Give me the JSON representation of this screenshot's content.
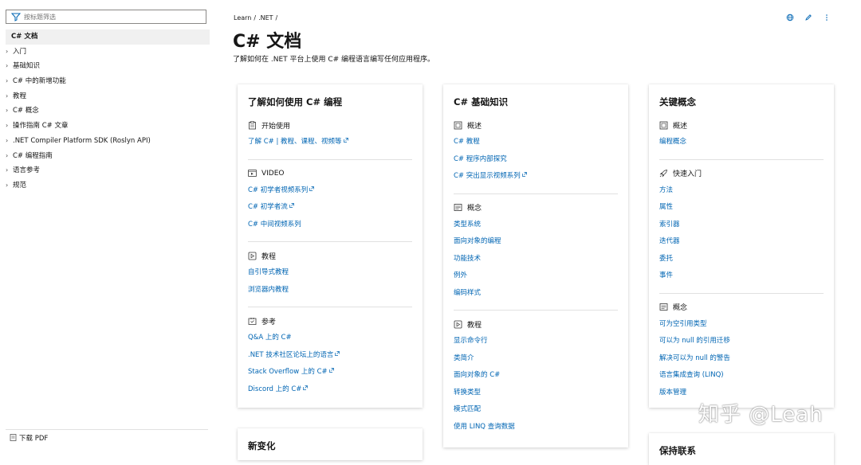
{
  "sidebar": {
    "filter_placeholder": "按标题筛选",
    "items": [
      {
        "label": "C# 文档",
        "active": true
      },
      {
        "label": "入门"
      },
      {
        "label": "基础知识"
      },
      {
        "label": "C# 中的新增功能"
      },
      {
        "label": "教程"
      },
      {
        "label": "C# 概念"
      },
      {
        "label": "操作指南 C# 文章"
      },
      {
        "label": ".NET Compiler Platform SDK (Roslyn API)"
      },
      {
        "label": "C# 编程指南"
      },
      {
        "label": "语言参考"
      },
      {
        "label": "规范"
      }
    ],
    "download_label": "下载 PDF"
  },
  "breadcrumb": [
    "Learn",
    ".NET"
  ],
  "breadcrumb_sep": "/",
  "page": {
    "title": "C# 文档",
    "description": "了解如何在 .NET 平台上使用 C# 编程语言编写任何应用程序。"
  },
  "top_icons": [
    "globe-icon",
    "edit-icon",
    "more-icon"
  ],
  "cards": {
    "learn": {
      "title": "了解如何使用 C# 编程",
      "sections": [
        {
          "icon": "get-started-icon",
          "title": "开始使用",
          "links": [
            {
              "text": "了解 C# | 教程、课程、视频等",
              "external": true
            }
          ]
        },
        {
          "icon": "video-icon",
          "title": "VIDEO",
          "links": [
            {
              "text": "C# 初学者视频系列",
              "external": true
            },
            {
              "text": "C# 初学者流",
              "external": true
            },
            {
              "text": "C# 中间视频系列",
              "external": false
            }
          ]
        },
        {
          "icon": "tutorial-icon",
          "title": "教程",
          "links": [
            {
              "text": "自引导式教程",
              "external": false
            },
            {
              "text": "浏览器内教程",
              "external": false
            }
          ]
        },
        {
          "icon": "reference-icon",
          "title": "参考",
          "links": [
            {
              "text": "Q&A 上的 C#",
              "external": false
            },
            {
              "text": ".NET 技术社区论坛上的语言",
              "external": true
            },
            {
              "text": "Stack Overflow 上的 C#",
              "external": true
            },
            {
              "text": "Discord 上的 C#",
              "external": true
            }
          ]
        }
      ]
    },
    "fundamentals": {
      "title": "C# 基础知识",
      "sections": [
        {
          "icon": "overview-icon",
          "title": "概述",
          "links": [
            {
              "text": "C# 教程",
              "external": false
            },
            {
              "text": "C# 程序内部探究",
              "external": false
            },
            {
              "text": "C# 突出显示视频系列",
              "external": true
            }
          ]
        },
        {
          "icon": "concept-icon",
          "title": "概念",
          "links": [
            {
              "text": "类型系统",
              "external": false
            },
            {
              "text": "面向对象的编程",
              "external": false
            },
            {
              "text": "功能技术",
              "external": false
            },
            {
              "text": "例外",
              "external": false
            },
            {
              "text": "编码样式",
              "external": false
            }
          ]
        },
        {
          "icon": "tutorial-icon",
          "title": "教程",
          "links": [
            {
              "text": "显示命令行",
              "external": false
            },
            {
              "text": "类简介",
              "external": false
            },
            {
              "text": "面向对象的 C#",
              "external": false
            },
            {
              "text": "转换类型",
              "external": false
            },
            {
              "text": "模式匹配",
              "external": false
            },
            {
              "text": "使用 LINQ 查询数据",
              "external": false
            }
          ]
        }
      ]
    },
    "key_concepts": {
      "title": "关键概念",
      "sections": [
        {
          "icon": "overview-icon",
          "title": "概述",
          "links": [
            {
              "text": "编程概念",
              "external": false
            }
          ]
        },
        {
          "icon": "quickstart-icon",
          "title": "快速入门",
          "links": [
            {
              "text": "方法",
              "external": false
            },
            {
              "text": "属性",
              "external": false
            },
            {
              "text": "索引器",
              "external": false
            },
            {
              "text": "迭代器",
              "external": false
            },
            {
              "text": "委托",
              "external": false
            },
            {
              "text": "事件",
              "external": false
            }
          ]
        },
        {
          "icon": "concept-icon",
          "title": "概念",
          "links": [
            {
              "text": "可为空引用类型",
              "external": false
            },
            {
              "text": "可以为 null 的引用迁移",
              "external": false
            },
            {
              "text": "解决可以为 null 的警告",
              "external": false
            },
            {
              "text": "语言集成查询 (LINQ)",
              "external": false
            },
            {
              "text": "版本管理",
              "external": false
            }
          ]
        }
      ]
    },
    "whats_new": {
      "title": "新变化"
    },
    "stay_connected": {
      "title": "保持联系"
    }
  },
  "watermark": "知乎 @Leah",
  "colors": {
    "link": "#0065b3",
    "text": "#161616",
    "active_bg": "#f0f0f0",
    "divider": "#e1e1e1"
  }
}
